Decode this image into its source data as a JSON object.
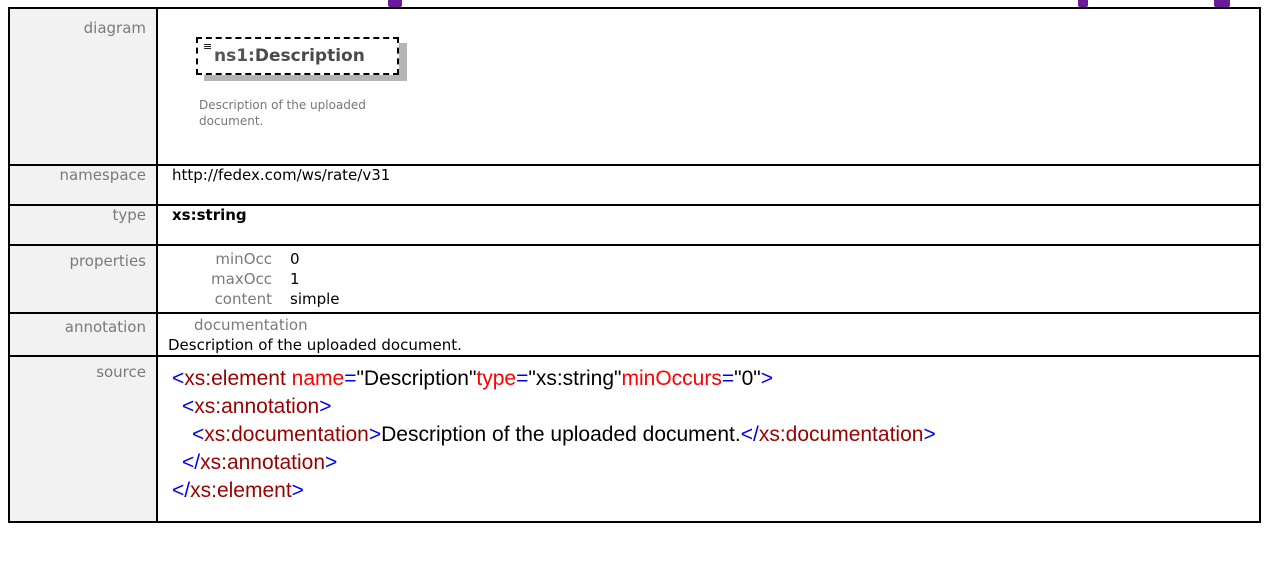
{
  "diagram": {
    "label": "diagram",
    "element_prefix": "ns1:",
    "element_name": "Description",
    "description": "Description of the uploaded document."
  },
  "namespace": {
    "label": "namespace",
    "value": "http://fedex.com/ws/rate/v31"
  },
  "type": {
    "label": "type",
    "value": "xs:string"
  },
  "properties": {
    "label": "properties",
    "items": [
      {
        "key": "minOcc",
        "value": "0"
      },
      {
        "key": "maxOcc",
        "value": "1"
      },
      {
        "key": "content",
        "value": "simple"
      }
    ]
  },
  "annotation": {
    "label": "annotation",
    "heading": "documentation",
    "text": "Description of the uploaded document."
  },
  "source": {
    "label": "source",
    "el_tag": "xs:element",
    "attr_name": "name",
    "attr_name_val": "\"Description\"",
    "attr_type": "type",
    "attr_type_val": "\"xs:string\"",
    "attr_min": "minOccurs",
    "attr_min_val": "\"0\"",
    "annotation_tag": "xs:annotation",
    "documentation_tag": "xs:documentation",
    "doc_text": "Description of the uploaded document."
  },
  "colors": {
    "tag": "#990000",
    "bracket": "#0000ee",
    "attribute": "#ff0000",
    "label_bg": "#f2f2f2",
    "label_text": "#7a7a7a",
    "accent": "#6a1b9a"
  }
}
